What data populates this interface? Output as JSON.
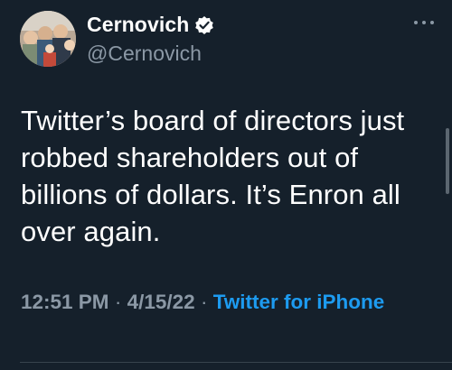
{
  "tweet": {
    "display_name": "Cernovich",
    "handle": "@Cernovich",
    "verified": true,
    "text": "Twitter’s board of directors just robbed shareholders out of billions of dollars. It’s Enron all over again.",
    "time": "12:51 PM",
    "separator": "·",
    "date": "4/15/22",
    "source": "Twitter for iPhone"
  },
  "icons": {
    "verified": "verified-badge-icon",
    "more": "more-options-icon"
  },
  "colors": {
    "background": "#15202b",
    "primary_text": "#ffffff",
    "secondary_text": "#8b98a5",
    "link": "#1d9bf0"
  }
}
